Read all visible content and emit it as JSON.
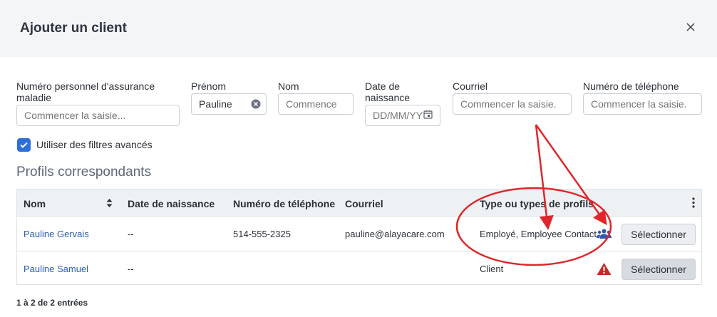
{
  "dialog": {
    "title": "Ajouter un client"
  },
  "filters": {
    "health_number": {
      "label": "Numéro personnel d'assurance maladie",
      "placeholder": "Commencer la saisie..."
    },
    "first_name": {
      "label": "Prénom",
      "value": "Pauline"
    },
    "last_name": {
      "label": "Nom",
      "placeholder": "Commence"
    },
    "birth_date": {
      "label": "Date de naissance",
      "placeholder": "DD/MM/YY"
    },
    "email": {
      "label": "Courriel",
      "placeholder": "Commencer la saisie."
    },
    "phone": {
      "label": "Numéro de téléphone",
      "placeholder": "Commencer la saisie."
    },
    "advanced": {
      "label": "Utiliser des filtres avancés",
      "checked": true
    }
  },
  "results": {
    "heading": "Profils correspondants",
    "columns": [
      "Nom",
      "Date de naissance",
      "Numéro de téléphone",
      "Courriel",
      "Type ou types de profils"
    ],
    "rows": [
      {
        "name": "Pauline Gervais",
        "birth_date": "--",
        "phone": "514-555-2325",
        "email": "pauline@alayacare.com",
        "profile_types": "Employé, Employee Contact",
        "status_icon": "users-icon",
        "action": "Sélectionner"
      },
      {
        "name": "Pauline Samuel",
        "birth_date": "--",
        "phone": "",
        "email": "",
        "profile_types": "Client",
        "status_icon": "warning-icon",
        "action": "Sélectionner"
      }
    ],
    "count_text": "1 à 2 de 2 entrées"
  },
  "colors": {
    "accent": "#2f6fd8",
    "link": "#2a5bb5",
    "warning": "#c62828",
    "annotation": "#e0262a"
  }
}
